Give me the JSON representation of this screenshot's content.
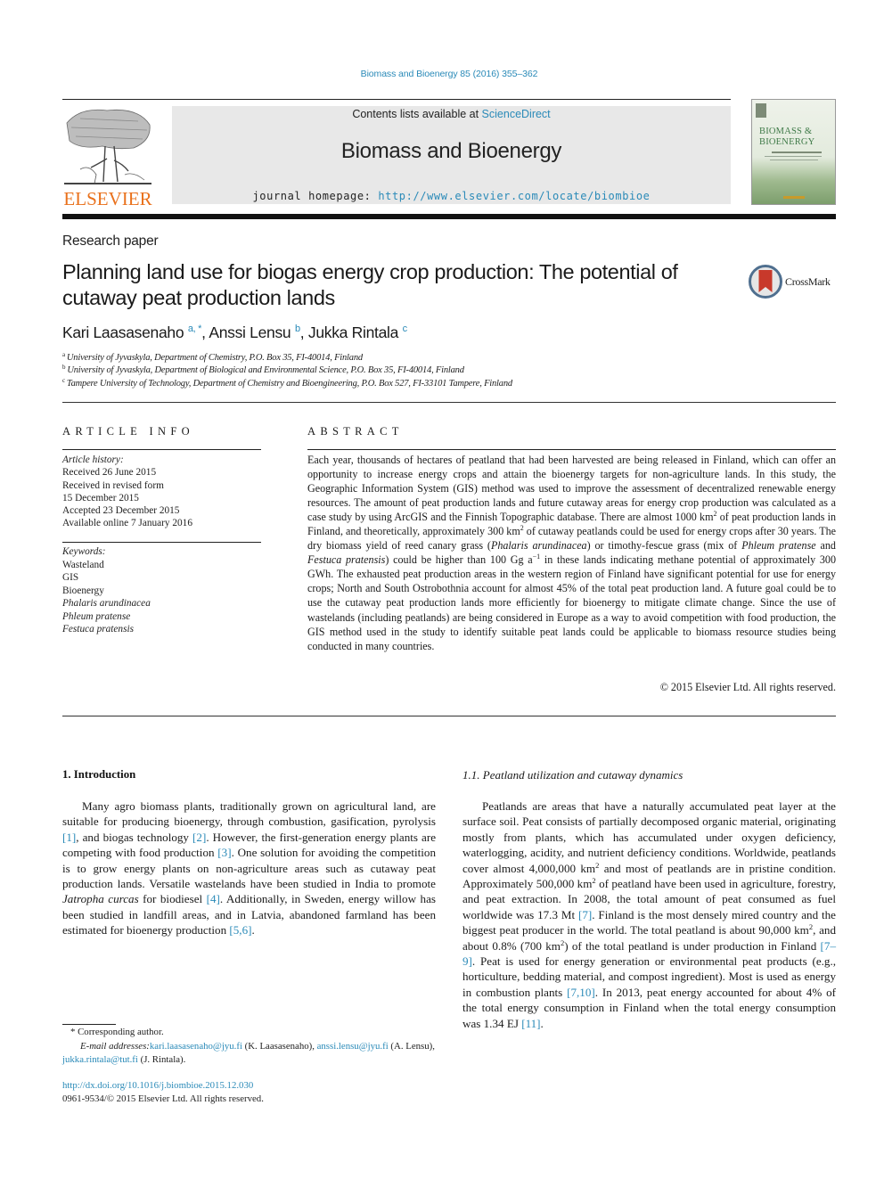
{
  "header": {
    "journal_ref": "Biomass and Bioenergy 85 (2016) 355–362",
    "contents_prefix": "Contents lists available at ",
    "contents_link": "ScienceDirect",
    "journal_title": "Biomass and Bioenergy",
    "homepage_prefix": "journal homepage: ",
    "homepage_url": "http://www.elsevier.com/locate/biombioe",
    "publisher_logo_text": "ELSEVIER",
    "cover": {
      "title_line1": "BIOMASS &",
      "title_line2": "BIOENERGY"
    },
    "colors": {
      "link": "#2a8ab8",
      "elsevier_orange": "#e9711c",
      "crossmark_red": "#c8392b"
    }
  },
  "article": {
    "type": "Research paper",
    "title": "Planning land use for biogas energy crop production: The potential of cutaway peat production lands",
    "crossmark_label": "CrossMark",
    "authors": [
      {
        "name": "Kari Laasasenaho",
        "marks": "a, *",
        "sep": ", "
      },
      {
        "name": "Anssi Lensu",
        "marks": "b",
        "sep": ", "
      },
      {
        "name": "Jukka Rintala",
        "marks": "c",
        "sep": ""
      }
    ],
    "affiliations": [
      {
        "mark": "a",
        "text": "University of Jyvaskyla, Department of Chemistry, P.O. Box 35, FI-40014, Finland"
      },
      {
        "mark": "b",
        "text": "University of Jyvaskyla, Department of Biological and Environmental Science, P.O. Box 35, FI-40014, Finland"
      },
      {
        "mark": "c",
        "text": "Tampere University of Technology, Department of Chemistry and Bioengineering, P.O. Box 527, FI-33101 Tampere, Finland"
      }
    ]
  },
  "article_info": {
    "heading": "ARTICLE INFO",
    "history_label": "Article history:",
    "history": [
      "Received 26 June 2015",
      "Received in revised form",
      "15 December 2015",
      "Accepted 23 December 2015",
      "Available online 7 January 2016"
    ],
    "keywords_label": "Keywords:",
    "keywords": [
      {
        "text": "Wasteland",
        "italic": false
      },
      {
        "text": "GIS",
        "italic": false
      },
      {
        "text": "Bioenergy",
        "italic": false
      },
      {
        "text": "Phalaris arundinacea",
        "italic": true
      },
      {
        "text": "Phleum pratense",
        "italic": true
      },
      {
        "text": "Festuca pratensis",
        "italic": true
      }
    ]
  },
  "abstract": {
    "heading": "ABSTRACT",
    "segments": [
      {
        "t": "Each year, thousands of hectares of peatland that had been harvested are being released in Finland, which can offer an opportunity to increase energy crops and attain the bioenergy targets for non-agriculture lands. In this study, the Geographic Information System (GIS) method was used to improve the assessment of decentralized renewable energy resources. The amount of peat production lands and future cutaway areas for energy crop production was calculated as a case study by using ArcGIS and the Finnish Topographic database. There are almost 1000 km"
      },
      {
        "t": "2",
        "sup": true
      },
      {
        "t": " of peat production lands in Finland, and theoretically, approximately 300 km"
      },
      {
        "t": "2",
        "sup": true
      },
      {
        "t": " of cutaway peatlands could be used for energy crops after 30 years. The dry biomass yield of reed canary grass ("
      },
      {
        "t": "Phalaris arundinacea",
        "i": true
      },
      {
        "t": ") or timothy-fescue grass (mix of "
      },
      {
        "t": "Phleum pratense",
        "i": true
      },
      {
        "t": " and "
      },
      {
        "t": "Festuca pratensis",
        "i": true
      },
      {
        "t": ") could be higher than 100 Gg a"
      },
      {
        "t": "−1",
        "sup": true
      },
      {
        "t": " in these lands indicating methane potential of approximately 300 GWh. The exhausted peat production areas in the western region of Finland have significant potential for use for energy crops; North and South Ostrobothnia account for almost 45% of the total peat production land. A future goal could be to use the cutaway peat production lands more efficiently for bioenergy to mitigate climate change. Since the use of wastelands (including peatlands) are being considered in Europe as a way to avoid competition with food production, the GIS method used in the study to identify suitable peat lands could be applicable to biomass resource studies being conducted in many countries."
      }
    ],
    "copyright": "© 2015 Elsevier Ltd. All rights reserved."
  },
  "intro": {
    "heading": "1.  Introduction",
    "segments": [
      {
        "t": "Many agro biomass plants, traditionally grown on agricultural land, are suitable for producing bioenergy, through combustion, gasification, pyrolysis "
      },
      {
        "t": "[1]",
        "link": true
      },
      {
        "t": ", and biogas technology "
      },
      {
        "t": "[2]",
        "link": true
      },
      {
        "t": ". However, the first-generation energy plants are competing with food production "
      },
      {
        "t": "[3]",
        "link": true
      },
      {
        "t": ". One solution for avoiding the competition is to grow energy plants on non-agriculture areas such as cutaway peat production lands. Versatile wastelands have been studied in India to promote "
      },
      {
        "t": "Jatropha curcas",
        "i": true
      },
      {
        "t": " for biodiesel "
      },
      {
        "t": "[4]",
        "link": true
      },
      {
        "t": ". Additionally, in Sweden, energy willow has been studied in landfill areas, and in Latvia, abandoned farmland has been estimated for bioenergy production "
      },
      {
        "t": "[5,6]",
        "link": true
      },
      {
        "t": "."
      }
    ]
  },
  "subsection": {
    "heading": "1.1.  Peatland utilization and cutaway dynamics",
    "segments": [
      {
        "t": "Peatlands are areas that have a naturally accumulated peat layer at the surface soil. Peat consists of partially decomposed organic material, originating mostly from plants, which has accumulated under oxygen deficiency, waterlogging, acidity, and nutrient deficiency conditions. Worldwide, peatlands cover almost 4,000,000 km"
      },
      {
        "t": "2",
        "sup": true
      },
      {
        "t": " and most of peatlands are in pristine condition. Approximately 500,000 km"
      },
      {
        "t": "2",
        "sup": true
      },
      {
        "t": " of peatland have been used in agriculture, forestry, and peat extraction. In 2008, the total amount of peat consumed as fuel worldwide was 17.3 Mt "
      },
      {
        "t": "[7]",
        "link": true
      },
      {
        "t": ". Finland is the most densely mired country and the biggest peat producer in the world. The total peatland is about 90,000 km"
      },
      {
        "t": "2",
        "sup": true
      },
      {
        "t": ", and about 0.8% (700 km"
      },
      {
        "t": "2",
        "sup": true
      },
      {
        "t": ") of the total peatland is under production in Finland "
      },
      {
        "t": "[7–9]",
        "link": true
      },
      {
        "t": ". Peat is used for energy generation or environmental peat products (e.g., horticulture, bedding material, and compost ingredient). Most is used as energy in combustion plants "
      },
      {
        "t": "[7,10]",
        "link": true
      },
      {
        "t": ". In 2013, peat energy accounted for about 4% of the total energy consumption in Finland when the total energy consumption was 1.34 EJ "
      },
      {
        "t": "[11]",
        "link": true
      },
      {
        "t": "."
      }
    ]
  },
  "footnotes": {
    "corresponding": "* Corresponding author.",
    "email_label": "E-mail addresses: ",
    "emails": [
      {
        "addr": "kari.laasasenaho@jyu.fi",
        "who": " (K. Laasasenaho), "
      },
      {
        "addr": "anssi.lensu@jyu.fi",
        "who": " (A. Lensu), "
      },
      {
        "addr": "jukka.rintala@tut.fi",
        "who": " (J. Rintala)."
      }
    ],
    "doi": "http://dx.doi.org/10.1016/j.biombioe.2015.12.030",
    "issn": "0961-9534/© 2015 Elsevier Ltd. All rights reserved."
  }
}
